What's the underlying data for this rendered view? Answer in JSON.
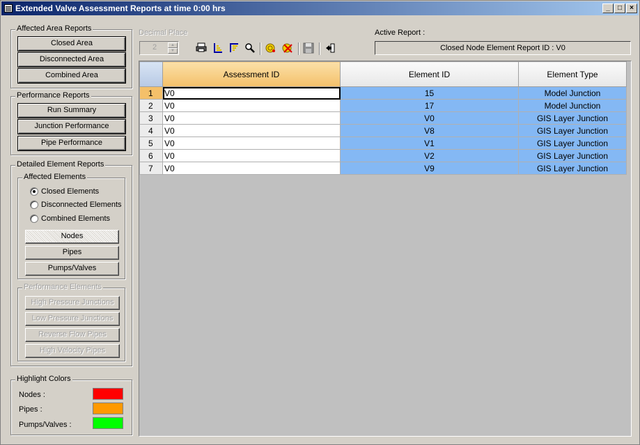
{
  "window": {
    "title": "Extended Valve Assessment Reports at time 0:00 hrs"
  },
  "affected_area": {
    "title": "Affected Area Reports",
    "buttons": [
      "Closed Area",
      "Disconnected Area",
      "Combined Area"
    ]
  },
  "performance": {
    "title": "Performance Reports",
    "buttons": [
      "Run Summary",
      "Junction Performance",
      "Pipe Performance"
    ]
  },
  "detailed": {
    "title": "Detailed Element Reports",
    "affected_title": "Affected Elements",
    "radios": [
      "Closed Elements",
      "Disconnected Elements",
      "Combined Elements"
    ],
    "selected_radio": "Closed Elements",
    "buttons": [
      "Nodes",
      "Pipes",
      "Pumps/Valves"
    ],
    "perf_title": "Performance Elements",
    "perf_buttons": [
      "High Pressure Junctions",
      "Low Pressure Junctions",
      "Reverse Flow Pipes",
      "High Velocity Pipes"
    ]
  },
  "highlight": {
    "title": "Highlight Colors",
    "items": [
      {
        "label": "Nodes :",
        "color": "#ff0000"
      },
      {
        "label": "Pipes :",
        "color": "#ff9900"
      },
      {
        "label": "Pumps/Valves :",
        "color": "#00ff00"
      }
    ]
  },
  "toolbar": {
    "decimal_label": "Decimal Place",
    "decimal_value": "2",
    "active_report_label": "Active Report :",
    "active_report_value": "Closed Node Element Report ID :  V0"
  },
  "table": {
    "columns": [
      "Assessment ID",
      "Element ID",
      "Element Type"
    ],
    "rows": [
      {
        "n": "1",
        "aid": "V0",
        "eid": "15",
        "etype": "Model Junction"
      },
      {
        "n": "2",
        "aid": "V0",
        "eid": "17",
        "etype": "Model Junction"
      },
      {
        "n": "3",
        "aid": "V0",
        "eid": "V0",
        "etype": "GIS Layer Junction"
      },
      {
        "n": "4",
        "aid": "V0",
        "eid": "V8",
        "etype": "GIS Layer Junction"
      },
      {
        "n": "5",
        "aid": "V0",
        "eid": "V1",
        "etype": "GIS Layer Junction"
      },
      {
        "n": "6",
        "aid": "V0",
        "eid": "V2",
        "etype": "GIS Layer Junction"
      },
      {
        "n": "7",
        "aid": "V0",
        "eid": "V9",
        "etype": "GIS Layer Junction"
      }
    ]
  }
}
